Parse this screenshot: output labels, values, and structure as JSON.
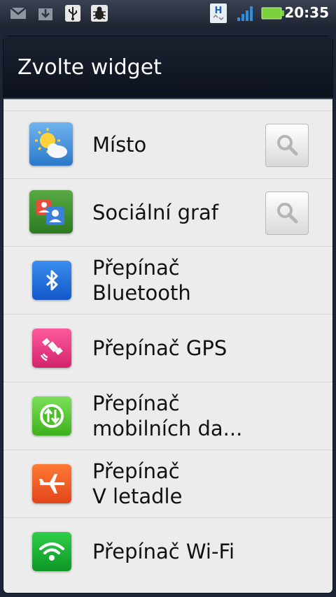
{
  "status_bar": {
    "time": "20:35",
    "network_type": "H",
    "icons": [
      "gmail-icon",
      "download-icon",
      "usb-icon",
      "debug-icon",
      "hspa-icon",
      "signal-icon",
      "battery-icon"
    ]
  },
  "dialog": {
    "title": "Zvolte widget"
  },
  "widgets": [
    {
      "label": "Místo",
      "icon": "weather-icon",
      "has_search": true
    },
    {
      "label": "Sociální graf",
      "icon": "social-graph-icon",
      "has_search": true
    },
    {
      "label_line1": "Přepínač",
      "label_line2": "Bluetooth",
      "icon": "bluetooth-icon",
      "has_search": false
    },
    {
      "label": "Přepínač GPS",
      "icon": "gps-icon",
      "has_search": false
    },
    {
      "label_line1": "Přepínač",
      "label_line2": "mobilních da...",
      "icon": "mobile-data-icon",
      "has_search": false
    },
    {
      "label_line1": "Přepínač",
      "label_line2": "V letadle",
      "icon": "airplane-icon",
      "has_search": false
    },
    {
      "label": "Přepínač Wi-Fi",
      "icon": "wifi-icon",
      "has_search": false
    }
  ],
  "colors": {
    "header_bg": "#0d121c",
    "list_bg": "#ececec",
    "battery": "#7bd23a",
    "signal": "#2e8fe0"
  }
}
